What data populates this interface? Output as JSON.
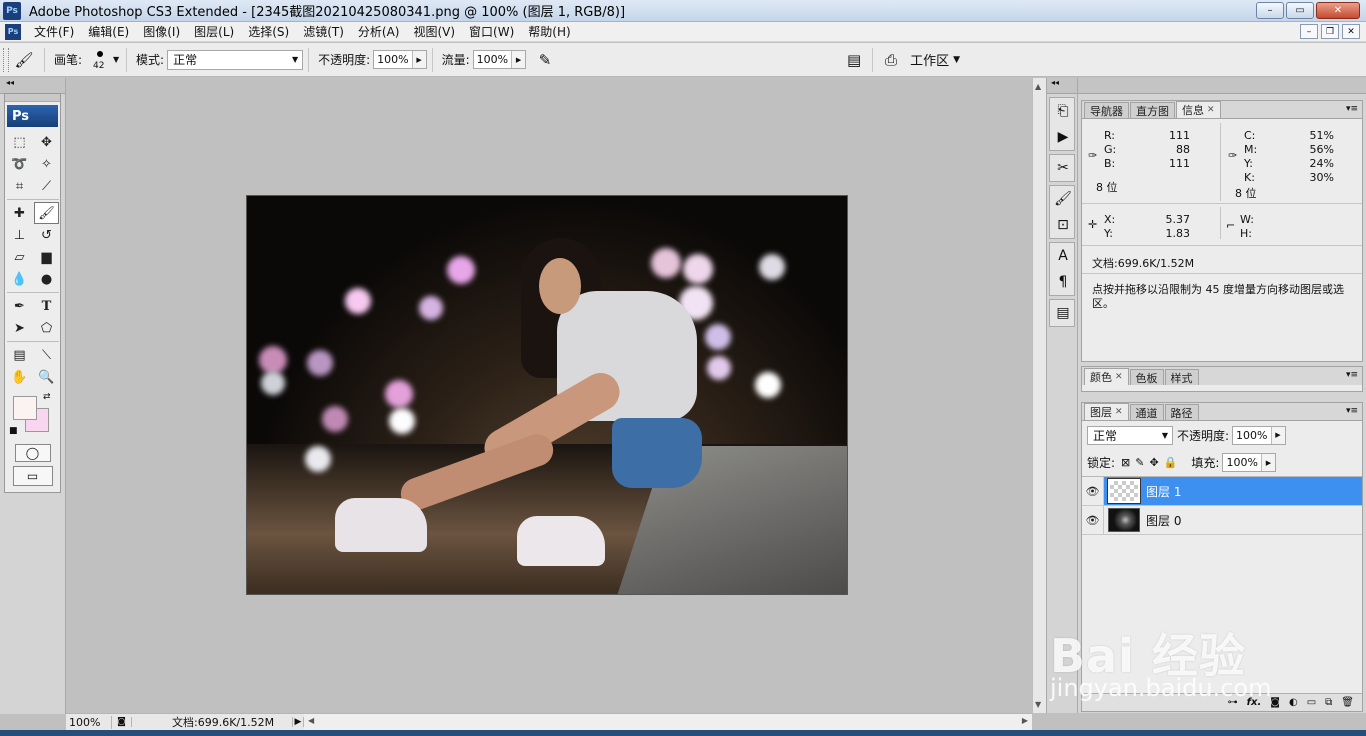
{
  "titlebar": {
    "logo": "Ps",
    "title": "Adobe Photoshop CS3 Extended - [2345截图20210425080341.png @ 100% (图层 1, RGB/8)]",
    "minimize": "–",
    "maximize": "▭",
    "close": "✕"
  },
  "menu": {
    "logo": "Ps",
    "items": [
      "文件(F)",
      "编辑(E)",
      "图像(I)",
      "图层(L)",
      "选择(S)",
      "滤镜(T)",
      "分析(A)",
      "视图(V)",
      "窗口(W)",
      "帮助(H)"
    ],
    "doc_min": "–",
    "doc_restore": "❐",
    "doc_close": "✕"
  },
  "options": {
    "brush_label": "画笔:",
    "brush_size": "42",
    "mode_label": "模式:",
    "mode_value": "正常",
    "opacity_label": "不透明度:",
    "opacity_value": "100%",
    "flow_label": "流量:",
    "flow_value": "100%",
    "workspace_label": "工作区"
  },
  "toolbox": {
    "logo": "Ps",
    "foreground_color": "#fbf2f2",
    "background_color": "#f9d6f0"
  },
  "statusbar": {
    "zoom": "100%",
    "docinfo": "文档:699.6K/1.52M"
  },
  "panels": {
    "info_panel": {
      "tabs": [
        "导航器",
        "直方图",
        "信息"
      ],
      "active_tab": "信息",
      "rgb": [
        {
          "label": "R:",
          "value": "111"
        },
        {
          "label": "G:",
          "value": "88"
        },
        {
          "label": "B:",
          "value": "111"
        }
      ],
      "rgb_bits": "8 位",
      "cmyk": [
        {
          "label": "C:",
          "value": "51%"
        },
        {
          "label": "M:",
          "value": "56%"
        },
        {
          "label": "Y:",
          "value": "24%"
        },
        {
          "label": "K:",
          "value": "30%"
        }
      ],
      "cmyk_bits": "8 位",
      "xy": [
        {
          "label": "X:",
          "value": "5.37"
        },
        {
          "label": "Y:",
          "value": "1.83"
        }
      ],
      "wh": [
        {
          "label": "W:",
          "value": ""
        },
        {
          "label": "H:",
          "value": ""
        }
      ],
      "docinfo": "文档:699.6K/1.52M",
      "hint": "点按并拖移以沿限制为 45 度增量方向移动图层或选区。"
    },
    "color_panel": {
      "tabs": [
        "颜色",
        "色板",
        "样式"
      ]
    },
    "layers_panel": {
      "tabs": [
        "图层",
        "通道",
        "路径"
      ],
      "blend_mode": "正常",
      "opacity_label": "不透明度:",
      "opacity_value": "100%",
      "lock_label": "锁定:",
      "fill_label": "填充:",
      "fill_value": "100%",
      "layers": [
        {
          "name": "图层 1",
          "selected": true
        },
        {
          "name": "图层 0",
          "selected": false
        }
      ],
      "footer_icons": [
        "link-icon",
        "fx-icon",
        "mask-icon",
        "adjustment-icon",
        "folder-icon",
        "new-layer-icon",
        "trash-icon"
      ],
      "footer_fx": "fx."
    }
  },
  "watermark": {
    "main": "Bai 经验",
    "sub": "jingyan.baidu.com"
  }
}
